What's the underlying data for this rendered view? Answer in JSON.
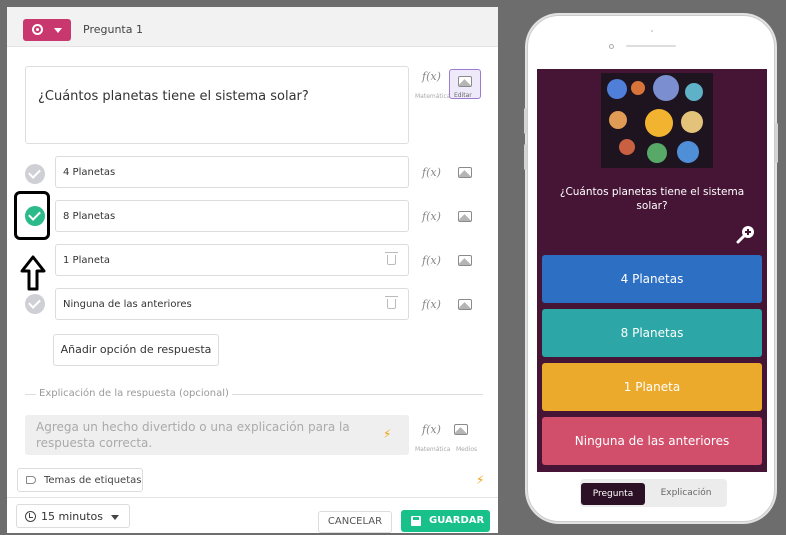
{
  "editor": {
    "question_label": "Pregunta 1",
    "question_text": "¿Cuántos planetas tiene el sistema solar?",
    "math_label": "Matemática",
    "edit_label": "Editar",
    "options": [
      {
        "text": "4 Planetas",
        "correct": false
      },
      {
        "text": "8 Planetas",
        "correct": true
      },
      {
        "text": "1 Planeta",
        "correct": false
      },
      {
        "text": "Ninguna de las anteriores",
        "correct": false
      }
    ],
    "add_option_label": "Añadir opción de respuesta",
    "explanation_label": "Explicación de la respuesta (opcional)",
    "explanation_placeholder": "Agrega un hecho divertido o una explicación para la respuesta correcta.",
    "media_label": "Medios",
    "tags_label": "Temas de etiquetas",
    "time_value": "15 minutos",
    "cancel_label": "CANCELAR",
    "save_label": "GUARDAR"
  },
  "preview": {
    "question_text": "¿Cuántos planetas tiene el sistema solar?",
    "answers": [
      {
        "text": "4 Planetas",
        "color": "#2d70c3"
      },
      {
        "text": "8 Planetas",
        "color": "#2ca6a6"
      },
      {
        "text": "1 Planeta",
        "color": "#ebaa2c"
      },
      {
        "text": "Ninguna de las anteriores",
        "color": "#d24f6c"
      }
    ],
    "tab_question": "Pregunta",
    "tab_explanation": "Explicación"
  },
  "colors": {
    "accent": "#c8386e",
    "correct": "#2bba8a",
    "save": "#18c08a",
    "preview_bg": "#461536"
  }
}
